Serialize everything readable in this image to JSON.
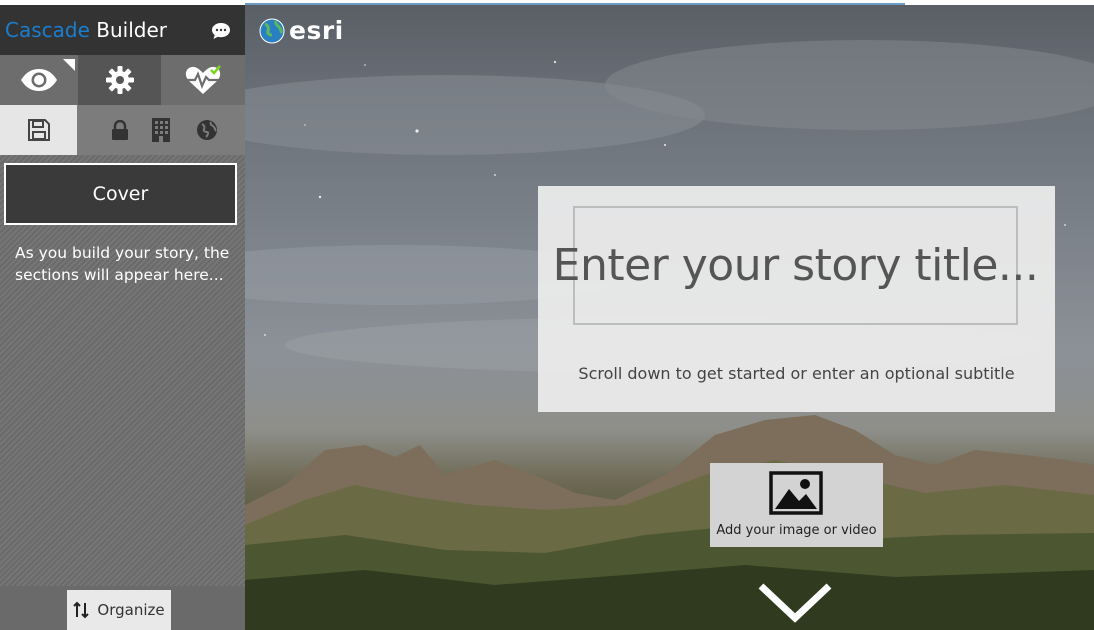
{
  "app": {
    "title_accent": "Cascade",
    "title_rest": "Builder"
  },
  "icons": {
    "chat": "chat-bubble-icon",
    "preview": "eye-icon",
    "settings": "gear-icon",
    "health": "heartbeat-check-icon",
    "save": "floppy-disk-icon",
    "lock": "lock-icon",
    "org": "building-icon",
    "public": "globe-icon",
    "organize": "sort-arrows-icon",
    "media": "image-icon",
    "scroll": "chevron-down-icon"
  },
  "sidebar": {
    "cover_label": "Cover",
    "sections_hint": "As you build your story, the sections will appear here...",
    "organize_label": "Organize"
  },
  "main": {
    "brand": "esri",
    "title_placeholder": "Enter your story title...",
    "subtitle_placeholder": "Scroll down to get started or enter an optional subtitle",
    "media_label": "Add your image or video"
  },
  "colors": {
    "accent": "#1a7ecf",
    "header": "#333333",
    "progress": "#6c9ac4"
  }
}
